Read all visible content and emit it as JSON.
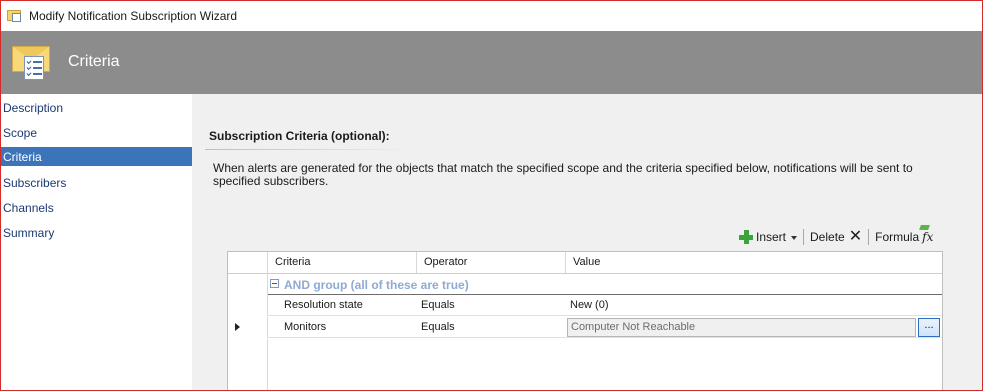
{
  "window": {
    "title": "Modify Notification Subscription Wizard",
    "frame_color": "#d42a2a"
  },
  "header": {
    "title": "Criteria",
    "background": "#8c8c8c",
    "icon": "envelope-checklist-icon"
  },
  "sidebar": {
    "items": [
      {
        "label": "Description",
        "active": false
      },
      {
        "label": "Scope",
        "active": false
      },
      {
        "label": "Criteria",
        "active": true
      },
      {
        "label": "Subscribers",
        "active": false
      },
      {
        "label": "Channels",
        "active": false
      },
      {
        "label": "Summary",
        "active": false
      }
    ],
    "active_color": "#3b74b8"
  },
  "main": {
    "section_title": "Subscription Criteria (optional):",
    "description": "When alerts are generated for the objects that match the specified scope and the criteria specified below, notifications will be sent to specified subscribers.",
    "toolbar": {
      "insert_label": "Insert",
      "delete_label": "Delete",
      "formula_label": "Formula"
    },
    "grid": {
      "columns": [
        "Criteria",
        "Operator",
        "Value"
      ],
      "group_label": "AND group (all of these are true)",
      "rows": [
        {
          "criteria": "Resolution state",
          "operator": "Equals",
          "value": "New (0)"
        },
        {
          "criteria": "Monitors",
          "operator": "Equals",
          "value": "Computer Not Reachable",
          "browse_label": "..."
        }
      ]
    }
  }
}
